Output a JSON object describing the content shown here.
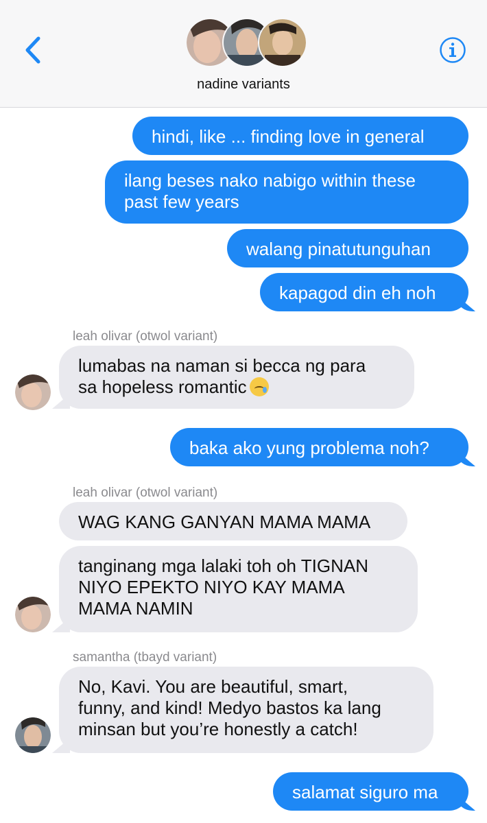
{
  "header": {
    "group_name": "nadine variants",
    "back_label": "<",
    "info_label": "i"
  },
  "colors": {
    "outgoing": "#1e88f5",
    "incoming": "#e9e9ee",
    "accent": "#1e88f5"
  },
  "messages": {
    "m1": "hindi, like ... finding love in general",
    "m2": "ilang beses nako nabigo within these\npast few years",
    "m3": "walang pinatutunguhan",
    "m4": "kapagod din eh noh",
    "s1": "leah olivar (otwol variant)",
    "m5": "lumabas na naman si becca ng para\nsa hopeless romantic",
    "m5_emoji": "crying-face-emoji",
    "m6": "baka ako yung problema noh?",
    "s2": "leah olivar (otwol variant)",
    "m7": "WAG KANG GANYAN MAMA MAMA",
    "m8": "tanginang mga lalaki toh oh TIGNAN\nNIYO EPEKTO NIYO KAY MAMA\nMAMA NAMIN",
    "s3": "samantha (tbayd variant)",
    "m9": "No, Kavi. You are beautiful, smart,\nfunny, and kind! Medyo bastos ka lang\nminsan but you’re honestly a catch!",
    "m10": "salamat siguro ma"
  }
}
